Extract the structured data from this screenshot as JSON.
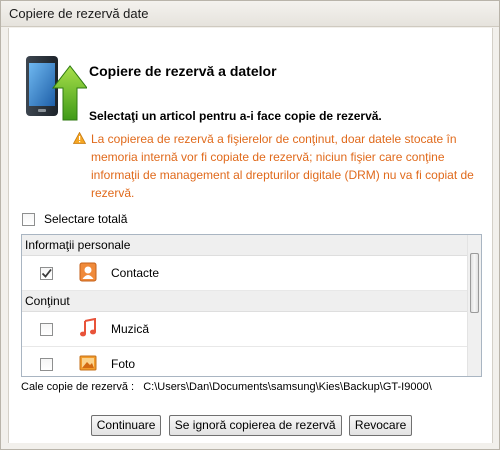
{
  "window": {
    "title": "Copiere de rezervă date"
  },
  "header": {
    "title": "Copiere de rezervă a datelor"
  },
  "instruction": "Selectaţi un articol pentru a-i face copie de rezervă.",
  "warning": "La copierea de rezervă a fişierelor de conţinut, doar datele stocate în memoria internă vor fi copiate de rezervă; niciun fişier care conţine informaţii de management al drepturilor digitale (DRM) nu va fi copiat de rezervă.",
  "select_all": {
    "label": "Selectare totală",
    "checked": false
  },
  "groups": [
    {
      "name": "Informaţii personale",
      "items": [
        {
          "label": "Contacte",
          "checked": true,
          "icon": "contacts-icon"
        }
      ]
    },
    {
      "name": "Conţinut",
      "items": [
        {
          "label": "Muzică",
          "checked": false,
          "icon": "music-icon"
        },
        {
          "label": "Foto",
          "checked": false,
          "icon": "photo-icon"
        }
      ]
    }
  ],
  "backup_path": {
    "label": "Cale copie de rezervă :",
    "value": "C:\\Users\\Dan\\Documents\\samsung\\Kies\\Backup\\GT-I9000\\"
  },
  "buttons": {
    "continue": "Continuare",
    "skip": "Se ignoră copierea de rezervă",
    "cancel": "Revocare"
  },
  "colors": {
    "warning_text": "#e06a1c",
    "list_border": "#a9b5c2"
  }
}
